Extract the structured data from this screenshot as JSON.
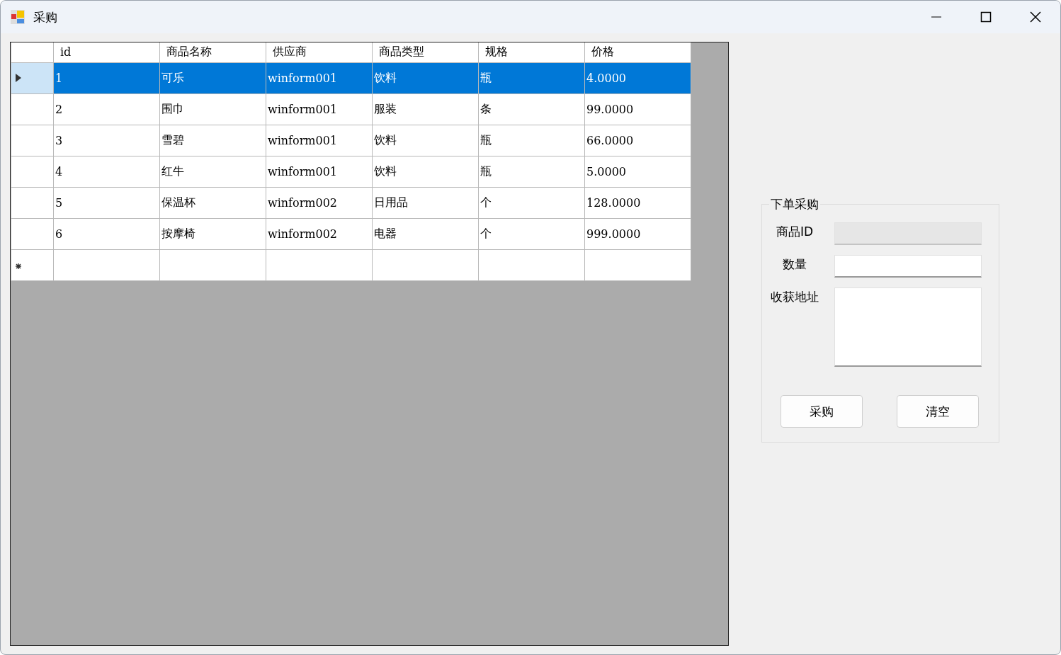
{
  "window": {
    "title": "采购"
  },
  "table": {
    "columns": [
      "id",
      "商品名称",
      "供应商",
      "商品类型",
      "规格",
      "价格"
    ],
    "rows": [
      {
        "cells": [
          "1",
          "可乐",
          "winform001",
          "饮料",
          "瓶",
          "4.0000"
        ],
        "selected": true
      },
      {
        "cells": [
          "2",
          "围巾",
          "winform001",
          "服装",
          "条",
          "99.0000"
        ],
        "selected": false
      },
      {
        "cells": [
          "3",
          "雪碧",
          "winform001",
          "饮料",
          "瓶",
          "66.0000"
        ],
        "selected": false
      },
      {
        "cells": [
          "4",
          "红牛",
          "winform001",
          "饮料",
          "瓶",
          "5.0000"
        ],
        "selected": false
      },
      {
        "cells": [
          "5",
          "保温杯",
          "winform002",
          "日用品",
          "个",
          "128.0000"
        ],
        "selected": false
      },
      {
        "cells": [
          "6",
          "按摩椅",
          "winform002",
          "电器",
          "个",
          "999.0000"
        ],
        "selected": false
      }
    ]
  },
  "order_form": {
    "title": "下单采购",
    "fields": [
      {
        "label": "商品ID",
        "kind": "text",
        "disabled": true
      },
      {
        "label": "数量",
        "kind": "text",
        "disabled": false
      },
      {
        "label": "收获地址",
        "kind": "multiline",
        "disabled": false
      }
    ],
    "buttons": [
      "采购",
      "清空"
    ]
  }
}
